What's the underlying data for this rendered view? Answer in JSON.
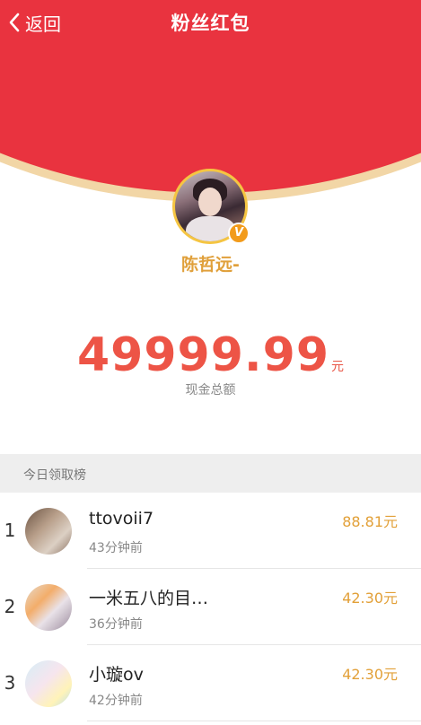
{
  "topbar": {
    "back_label": "返回",
    "title": "粉丝红包"
  },
  "sender": {
    "name": "陈哲远-",
    "verified_badge": "V"
  },
  "total": {
    "amount": "49999.99",
    "unit": "元",
    "label": "现金总额"
  },
  "leaderboard": {
    "title": "今日领取榜",
    "rows": [
      {
        "rank": "1",
        "name": "ttovoii7",
        "time": "43分钟前",
        "amount": "88.81元"
      },
      {
        "rank": "2",
        "name": "一米五八的目…",
        "time": "36分钟前",
        "amount": "42.30元"
      },
      {
        "rank": "3",
        "name": "小璇ov",
        "time": "42分钟前",
        "amount": "42.30元"
      }
    ]
  },
  "colors": {
    "header_red": "#e9333f",
    "header_arc_gold": "#f2d6a6",
    "amount_red": "#ed5446",
    "gold_text": "#e0a03b"
  },
  "icons": [
    "chevron-left-icon",
    "verified-badge-icon"
  ]
}
